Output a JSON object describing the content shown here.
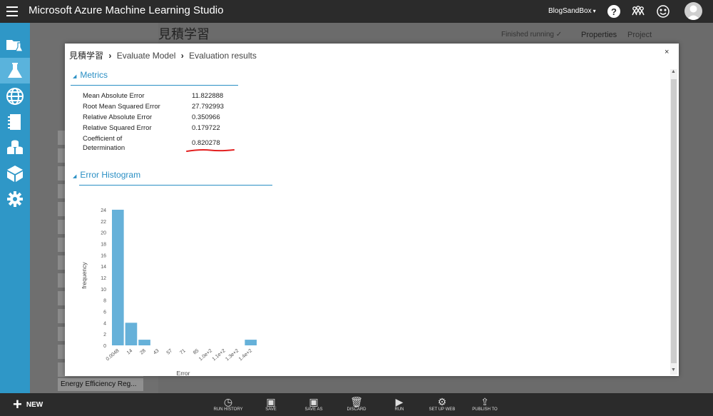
{
  "topbar": {
    "app_title": "Microsoft Azure Machine Learning Studio",
    "workspace": "BlogSandBox",
    "workspace_caret": "▾"
  },
  "background": {
    "experiment_title": "見積学習",
    "status": "Finished running ✓",
    "properties_tab": "Properties",
    "project_tab": "Project",
    "palette_bottom_item": "Energy Efficiency Reg..."
  },
  "modal": {
    "breadcrumb": [
      "見積学習",
      "Evaluate Model",
      "Evaluation results"
    ],
    "close": "×",
    "metrics_title": "Metrics",
    "metrics": [
      {
        "label": "Mean Absolute Error",
        "value": "11.822888"
      },
      {
        "label": "Root Mean Squared Error",
        "value": "27.792993"
      },
      {
        "label": "Relative Absolute Error",
        "value": "0.350966"
      },
      {
        "label": "Relative Squared Error",
        "value": "0.179722"
      },
      {
        "label": "Coefficient of Determination",
        "value": "0.820278"
      }
    ],
    "histogram_title": "Error Histogram",
    "highlight_color": "#e32020"
  },
  "chart_data": {
    "type": "bar",
    "title": "",
    "xlabel": "Error",
    "ylabel": "frequency",
    "ylim": [
      0,
      25
    ],
    "yticks": [
      0,
      2,
      4,
      6,
      8,
      10,
      12,
      14,
      16,
      18,
      20,
      22,
      24
    ],
    "categories": [
      "0.0048",
      "14",
      "28",
      "43",
      "57",
      "71",
      "85",
      "1.0e+2",
      "1.1e+2",
      "1.3e+2",
      "1.4e+2"
    ],
    "values": [
      24,
      4,
      1,
      0,
      0,
      0,
      0,
      0,
      0,
      0,
      1
    ],
    "bar_color": "#66b1d9",
    "grid": false
  },
  "bottombar": {
    "new_label": "NEW",
    "items": [
      "RUN HISTORY",
      "SAVE",
      "SAVE AS",
      "DISCARD",
      "RUN",
      "SET UP WEB",
      "PUBLISH TO"
    ]
  }
}
